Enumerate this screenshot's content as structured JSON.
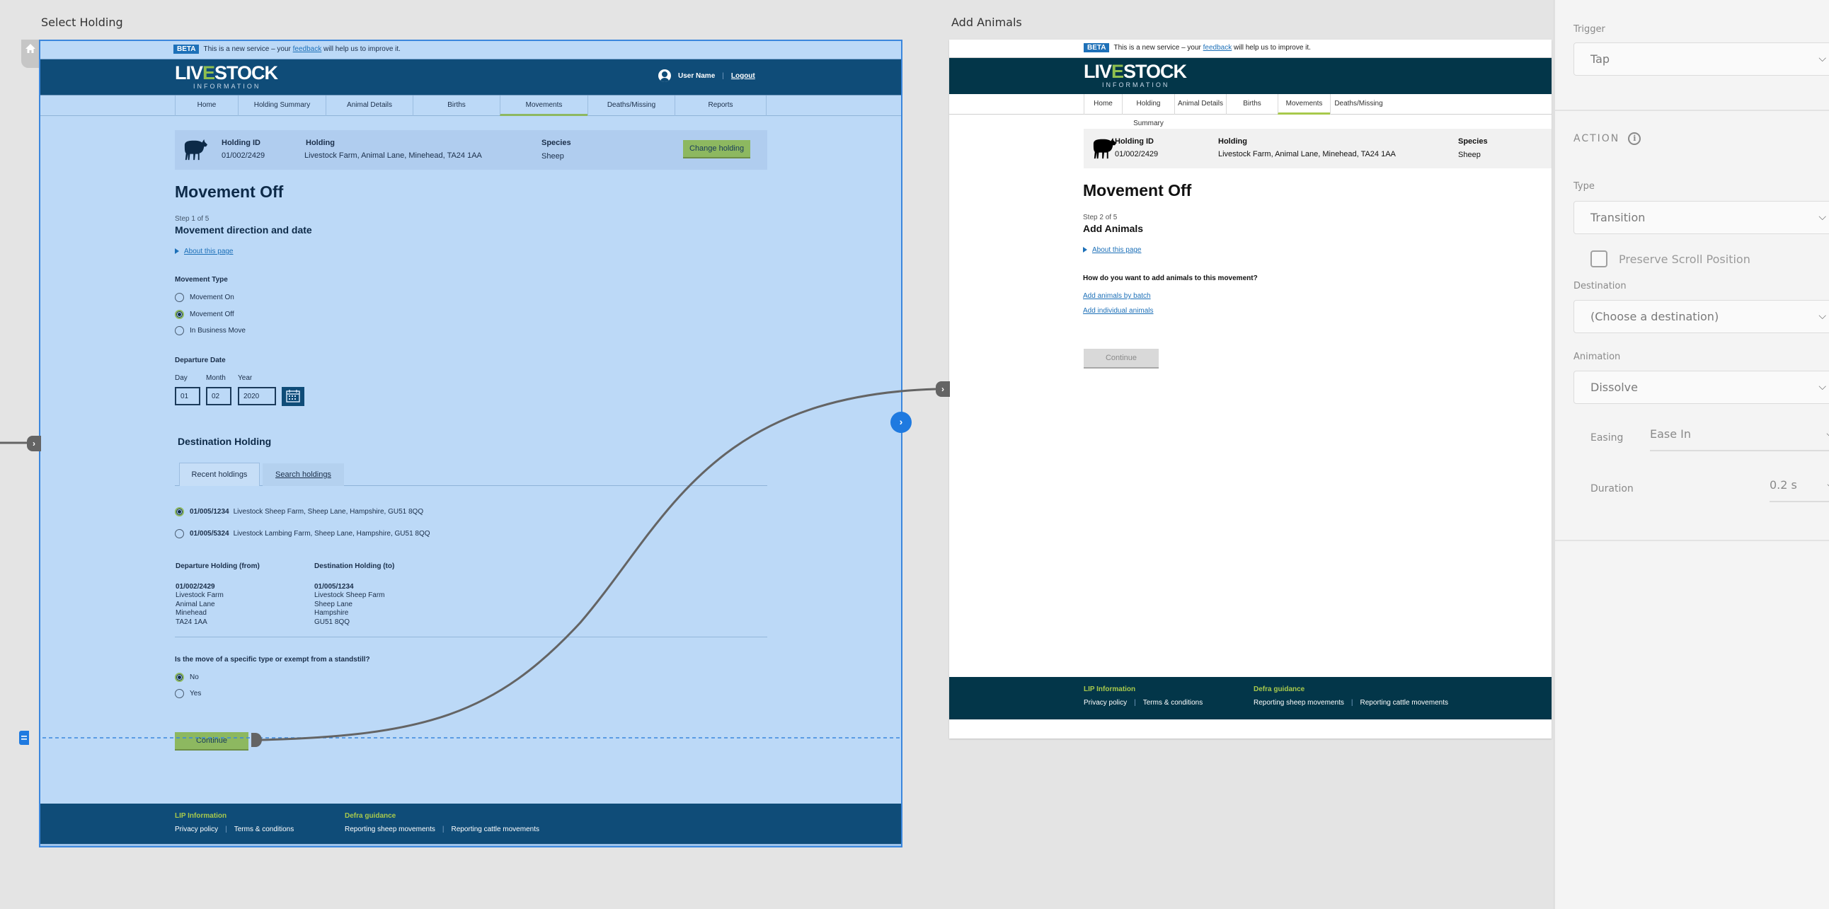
{
  "canvas": {
    "left_artboard_title": "Select Holding",
    "right_artboard_title": "Add Animals"
  },
  "site": {
    "beta_tag": "BETA",
    "beta_text_before": "This is a new service – your ",
    "beta_link": "feedback",
    "beta_text_after": " will help us to improve it.",
    "logo_main_a": "LIV",
    "logo_main_e": "E",
    "logo_main_b": "STOCK",
    "logo_sub": "INFORMATION",
    "user_name": "User Name",
    "user_separator": "|",
    "logout": "Logout",
    "nav": [
      "Home",
      "Holding Summary",
      "Animal Details",
      "Births",
      "Movements",
      "Deaths/Missing",
      "Reports"
    ],
    "nav_active": "Movements",
    "holding": {
      "id_label": "Holding ID",
      "id_value": "01/002/2429",
      "holding_label": "Holding",
      "holding_value": "Livestock Farm, Animal Lane, Minehead, TA24 1AA",
      "species_label": "Species",
      "species_value": "Sheep",
      "change_button": "Change holding"
    },
    "footer": {
      "col1_head": "LIP Information",
      "col1_links": [
        "Privacy policy",
        "Terms & conditions"
      ],
      "col2_head": "Defra guidance",
      "col2_links": [
        "Reporting sheep movements",
        "Reporting cattle movements"
      ],
      "separator": "|"
    }
  },
  "select_holding": {
    "page_title": "Movement Off",
    "step": "Step 1 of 5",
    "section_title": "Movement direction and date",
    "about_link": "About this page",
    "movement_type_label": "Movement Type",
    "movement_types": [
      {
        "label": "Movement On",
        "checked": false
      },
      {
        "label": "Movement Off",
        "checked": true
      },
      {
        "label": "In Business Move",
        "checked": false
      }
    ],
    "departure_date_label": "Departure Date",
    "day_label": "Day",
    "month_label": "Month",
    "year_label": "Year",
    "day_value": "01",
    "month_value": "02",
    "year_value": "2020",
    "destination_title": "Destination Holding",
    "tabs": [
      "Recent holdings",
      "Search holdings"
    ],
    "active_tab": "Recent holdings",
    "recent_holdings": [
      {
        "id": "01/005/1234",
        "address": "Livestock Sheep Farm, Sheep Lane, Hampshire, GU51 8QQ",
        "checked": true
      },
      {
        "id": "01/005/5324",
        "address": "Livestock Lambing Farm, Sheep Lane, Hampshire, GU51 8QQ",
        "checked": false
      }
    ],
    "departure_heading": "Departure Holding (from)",
    "departure_lines": [
      "01/002/2429",
      "Livestock Farm",
      "Animal Lane",
      "Minehead",
      "TA24 1AA"
    ],
    "destination_heading": "Destination Holding (to)",
    "destination_lines": [
      "01/005/1234",
      "Livestock Sheep Farm",
      "Sheep Lane",
      "Hampshire",
      "GU51 8QQ"
    ],
    "standstill_question": "Is the move of a specific type or exempt from a standstill?",
    "standstill_options": [
      {
        "label": "No",
        "checked": true
      },
      {
        "label": "Yes",
        "checked": false
      }
    ],
    "continue_button": "Continue"
  },
  "add_animals": {
    "page_title": "Movement Off",
    "step": "Step 2 of 5",
    "section_title": "Add Animals",
    "about_link": "About this page",
    "question": "How do you want to add animals to this movement?",
    "links": [
      "Add animals by batch",
      "Add individual animals"
    ],
    "continue_button": "Continue"
  },
  "interaction_panel": {
    "trigger_label": "Trigger",
    "trigger_value": "Tap",
    "action_heading": "ACTION",
    "type_label": "Type",
    "type_value": "Transition",
    "preserve_scroll_label": "Preserve Scroll Position",
    "preserve_scroll_checked": false,
    "destination_label": "Destination",
    "destination_value": "(Choose a destination)",
    "animation_label": "Animation",
    "animation_value": "Dissolve",
    "easing_label": "Easing",
    "easing_value": "Ease In",
    "duration_label": "Duration",
    "duration_value": "0.2 s"
  },
  "colors": {
    "selection_blue": "#3b87dd",
    "left_header": "#0f4c78",
    "right_header": "#033649",
    "accent_green": "#8db860",
    "footer_head_green": "#a8c94c"
  }
}
